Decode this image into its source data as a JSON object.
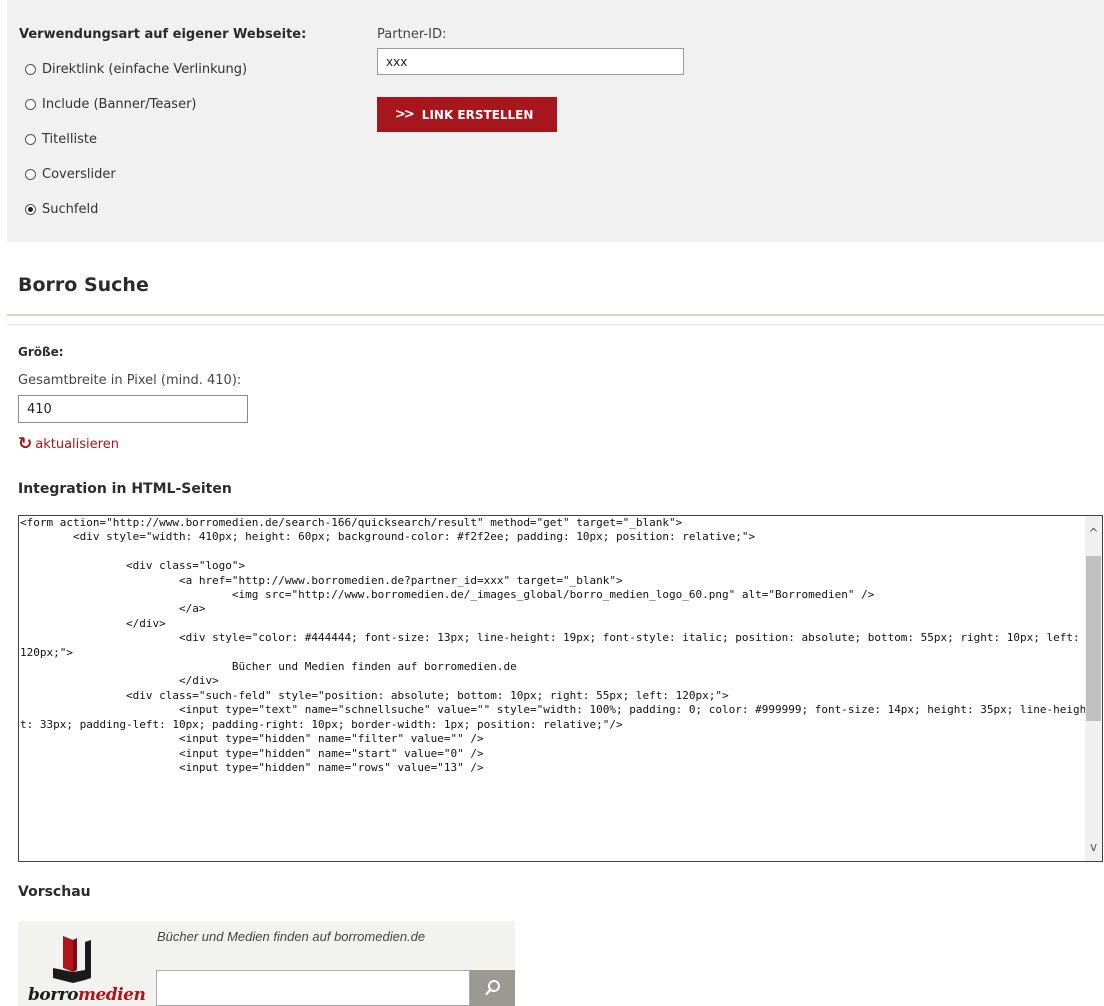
{
  "usage": {
    "title": "Verwendungsart auf eigener Webseite:",
    "options": [
      {
        "label": "Direktlink (einfache Verlinkung)",
        "checked": false
      },
      {
        "label": "Include (Banner/Teaser)",
        "checked": false
      },
      {
        "label": "Titelliste",
        "checked": false
      },
      {
        "label": "Coverslider",
        "checked": false
      },
      {
        "label": "Suchfeld",
        "checked": true
      }
    ]
  },
  "partner": {
    "label": "Partner-ID:",
    "value": "xxx",
    "button_label": "LINK ERSTELLEN",
    "button_icon": "double-chevron-right-icon"
  },
  "section": {
    "title": "Borro Suche"
  },
  "size": {
    "heading": "Größe:",
    "width_label": "Gesamtbreite in Pixel (mind. 410):",
    "width_value": "410",
    "refresh_label": "aktualisieren",
    "refresh_icon": "refresh-icon"
  },
  "integration": {
    "title": "Integration in HTML-Seiten",
    "code": "<form action=\"http://www.borromedien.de/search-166/quicksearch/result\" method=\"get\" target=\"_blank\">\n\t<div style=\"width: 410px; height: 60px; background-color: #f2f2ee; padding: 10px; position: relative;\">\n\n\t\t<div class=\"logo\">\n\t\t\t<a href=\"http://www.borromedien.de?partner_id=xxx\" target=\"_blank\">\n\t\t\t\t<img src=\"http://www.borromedien.de/_images_global/borro_medien_logo_60.png\" alt=\"Borromedien\" />\n\t\t\t</a>\n\t\t</div>\n\t\t\t<div style=\"color: #444444; font-size: 13px; line-height: 19px; font-style: italic; position: absolute; bottom: 55px; right: 10px; left: 120px;\">\n\t\t\t\tBücher und Medien finden auf borromedien.de\n\t\t\t</div>\n\t\t<div class=\"such-feld\" style=\"position: absolute; bottom: 10px; right: 55px; left: 120px;\">\n\t\t\t<input type=\"text\" name=\"schnellsuche\" value=\"\" style=\"width: 100%; padding: 0; color: #999999; font-size: 14px; height: 35px; line-height: 33px; padding-left: 10px; padding-right: 10px; border-width: 1px; position: relative;\"/>\n\t\t\t<input type=\"hidden\" name=\"filter\" value=\"\" />\n\t\t\t<input type=\"hidden\" name=\"start\" value=\"0\" />\n\t\t\t<input type=\"hidden\" name=\"rows\" value=\"13\" />"
  },
  "preview": {
    "title": "Vorschau",
    "logo_text_dark": "borro",
    "logo_text_red": "medien",
    "tagline": "Bücher und Medien finden auf borromedien.de",
    "search_icon": "search-icon",
    "colors": {
      "brand_red": "#a8161d",
      "widget_bg": "#f2f2ee",
      "search_button": "#9b9a92"
    }
  }
}
